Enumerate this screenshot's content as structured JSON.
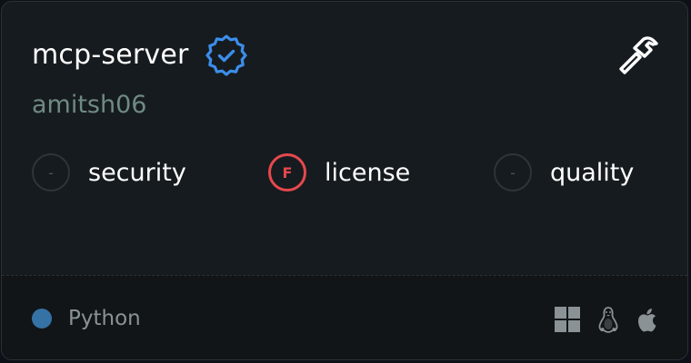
{
  "header": {
    "title": "mcp-server",
    "owner": "amitsh06"
  },
  "scores": [
    {
      "grade": "-",
      "label": "security",
      "status": "neutral"
    },
    {
      "grade": "F",
      "label": "license",
      "status": "fail"
    },
    {
      "grade": "-",
      "label": "quality",
      "status": "neutral"
    }
  ],
  "footer": {
    "language": "Python",
    "platforms": [
      "windows-icon",
      "linux-icon",
      "apple-icon"
    ]
  },
  "colors": {
    "background": "#161b1f",
    "verified_badge": "#3b8eea",
    "fail": "#e5484d",
    "language_dot": "#3572A5"
  }
}
